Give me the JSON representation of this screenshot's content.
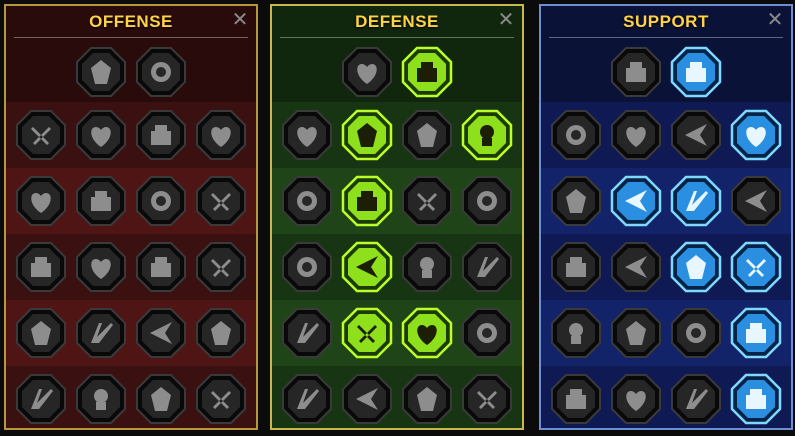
{
  "colors": {
    "title": "#ffd24a",
    "active_green": "#8fe01c",
    "active_blue": "#2a8fe0"
  },
  "panels": [
    {
      "key": "offense",
      "title": "OFFENSE",
      "close_label": "✕",
      "top": [
        {
          "icon": "crossed-swords-icon",
          "active": false
        },
        {
          "icon": "claw-slash-icon",
          "active": false
        }
      ],
      "rows": [
        [
          {
            "icon": "demon-bust-icon",
            "active": false
          },
          {
            "icon": "blades-slash-icon",
            "active": false
          },
          {
            "icon": "shield-sword-icon",
            "active": false
          },
          {
            "icon": "heart-crack-icon",
            "active": false
          }
        ],
        [
          {
            "icon": "fist-strike-icon",
            "active": false
          },
          {
            "icon": "fanged-maw-icon",
            "active": false
          },
          {
            "icon": "skull-bubbles-icon",
            "active": false
          },
          {
            "icon": "reaper-scythe-icon",
            "active": false
          }
        ],
        [
          {
            "icon": "bleeding-heart-sword-icon",
            "active": false
          },
          {
            "icon": "hammer-fist-icon",
            "active": false
          },
          {
            "icon": "battle-axe-icon",
            "active": false
          },
          {
            "icon": "chain-lightning-icon",
            "active": false
          }
        ],
        [
          {
            "icon": "shattered-ground-icon",
            "active": false
          },
          {
            "icon": "skull-cluster-icon",
            "active": false
          },
          {
            "icon": "sword-ring-icon",
            "active": false
          },
          {
            "icon": "warrior-flex-icon",
            "active": false
          }
        ],
        [
          {
            "icon": "blade-sparkles-icon",
            "active": false
          },
          {
            "icon": "knight-helmet-icon",
            "active": false
          },
          {
            "icon": "winged-beast-icon",
            "active": false
          },
          {
            "icon": "skull-fire-icon",
            "active": false
          }
        ]
      ]
    },
    {
      "key": "defense",
      "title": "DEFENSE",
      "close_label": "✕",
      "top": [
        {
          "icon": "armor-plates-icon",
          "active": false
        },
        {
          "icon": "raised-fist-icon",
          "active": true
        }
      ],
      "rows": [
        [
          {
            "icon": "chevron-shield-icon",
            "active": false
          },
          {
            "icon": "burning-heart-icon",
            "active": true
          },
          {
            "icon": "stone-golem-icon",
            "active": false
          },
          {
            "icon": "broken-sword-icon",
            "active": true
          }
        ],
        [
          {
            "icon": "hand-block-icon",
            "active": false
          },
          {
            "icon": "knight-shield-icon",
            "active": true
          },
          {
            "icon": "skull-heart-icon",
            "active": false
          },
          {
            "icon": "hooded-face-icon",
            "active": false
          }
        ],
        [
          {
            "icon": "crowd-figures-icon",
            "active": false
          },
          {
            "icon": "hourglass-skull-icon",
            "active": true
          },
          {
            "icon": "open-palm-icon",
            "active": false
          },
          {
            "icon": "bull-head-icon",
            "active": false
          }
        ],
        [
          {
            "icon": "running-figure-icon",
            "active": false
          },
          {
            "icon": "dripping-flames-icon",
            "active": true
          },
          {
            "icon": "radiant-skull-icon",
            "active": true
          },
          {
            "icon": "swirl-shield-icon",
            "active": false
          }
        ],
        [
          {
            "icon": "flaming-beast-icon",
            "active": false
          },
          {
            "icon": "spiked-shield-icon",
            "active": false
          },
          {
            "icon": "bearded-dwarf-icon",
            "active": false
          },
          {
            "icon": "muscle-man-icon",
            "active": false
          }
        ]
      ]
    },
    {
      "key": "support",
      "title": "SUPPORT",
      "close_label": "✕",
      "top": [
        {
          "icon": "heart-plus-icon",
          "active": false
        },
        {
          "icon": "hand-swirl-icon",
          "active": true
        }
      ],
      "rows": [
        [
          {
            "icon": "praying-hands-icon",
            "active": false
          },
          {
            "icon": "rainbow-arc-icon",
            "active": false
          },
          {
            "icon": "flaming-skull-icon",
            "active": false
          },
          {
            "icon": "speed-arrow-icon",
            "active": true
          }
        ],
        [
          {
            "icon": "sparkle-person-icon",
            "active": false
          },
          {
            "icon": "lightning-bolt-icon",
            "active": true
          },
          {
            "icon": "crack-ground-icon",
            "active": true
          },
          {
            "icon": "duo-figures-icon",
            "active": false
          }
        ],
        [
          {
            "icon": "chained-heart-icon",
            "active": false
          },
          {
            "icon": "comet-icon",
            "active": false
          },
          {
            "icon": "open-book-icon",
            "active": true
          },
          {
            "icon": "angry-eyes-icon",
            "active": true
          }
        ],
        [
          {
            "icon": "compass-star-icon",
            "active": false
          },
          {
            "icon": "swift-boot-icon",
            "active": false
          },
          {
            "icon": "watching-eye-icon",
            "active": false
          },
          {
            "icon": "dancing-figure-icon",
            "active": true
          }
        ],
        [
          {
            "icon": "potion-flask-icon",
            "active": false
          },
          {
            "icon": "skull-wreath-icon",
            "active": false
          },
          {
            "icon": "fist-shield-icon",
            "active": false
          },
          {
            "icon": "eagle-head-icon",
            "active": true
          }
        ]
      ]
    }
  ]
}
